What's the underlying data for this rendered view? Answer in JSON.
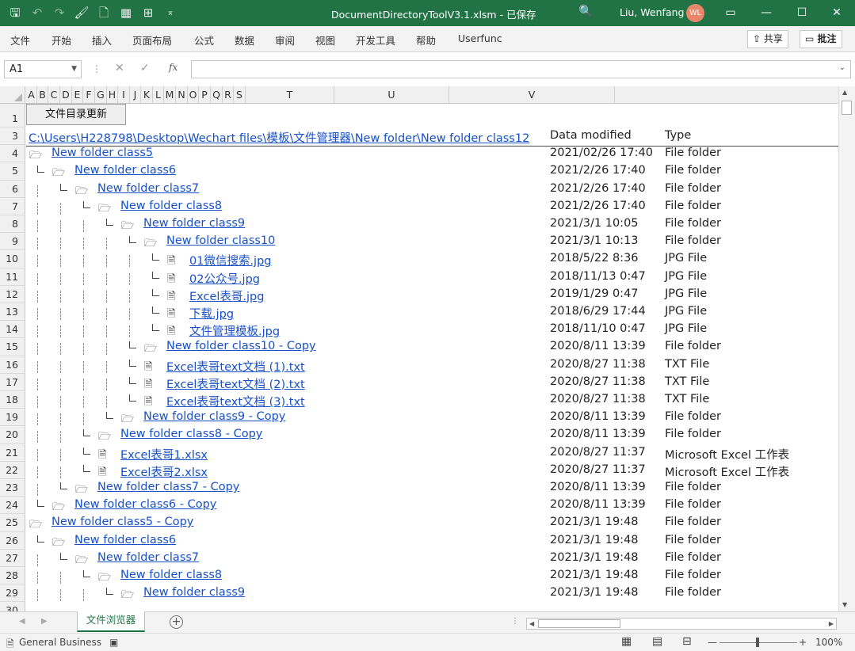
{
  "title": {
    "text": "DocumentDirectoryToolV3.1.xlsm  -  已保存",
    "user": "Liu, Wenfang",
    "avatar": "WL",
    "search_icon": "🔍",
    "qat_icons": [
      "save-icon",
      "undo-icon",
      "redo-icon",
      "format-painter-icon",
      "print-preview-icon",
      "table-icon",
      "borders-icon",
      "customize-qat-icon"
    ],
    "window_buttons": {
      "ribbon_display": "▭",
      "minimize": "—",
      "maximize": "☐",
      "close": "✕"
    },
    "accent": "#217346"
  },
  "ribbon": {
    "tabs": [
      "文件",
      "开始",
      "插入",
      "页面布局",
      "公式",
      "数据",
      "审阅",
      "视图",
      "开发工具",
      "帮助",
      "Userfunc"
    ],
    "share": "共享",
    "comments": "批注"
  },
  "formula_bar": {
    "name_box": "A1",
    "cancel": "✕",
    "enter": "✓",
    "fx": "fx",
    "value": ""
  },
  "columns": [
    "A",
    "B",
    "C",
    "D",
    "E",
    "F",
    "G",
    "H",
    "I",
    "J",
    "K",
    "L",
    "M",
    "N",
    "O",
    "P",
    "Q",
    "R",
    "S",
    "T",
    "U",
    "V"
  ],
  "row_numbers": [
    "1",
    "3",
    "4",
    "5",
    "6",
    "7",
    "8",
    "9",
    "10",
    "11",
    "12",
    "13",
    "14",
    "15",
    "16",
    "17",
    "18",
    "19",
    "20",
    "21",
    "22",
    "23",
    "24",
    "25",
    "26",
    "27",
    "28",
    "29",
    "30"
  ],
  "sheet": {
    "update_button": "文件目录更新",
    "path": "C:\\Users\\H228798\\Desktop\\Wechart files\\模板\\文件管理器\\New folder\\New folder class12",
    "header_date": "Data modified",
    "header_type": "Type",
    "rows": [
      {
        "depth": 0,
        "kind": "folder",
        "name": "New folder class5",
        "date": "2021/02/26 17:40",
        "type": "File folder"
      },
      {
        "depth": 1,
        "kind": "folder",
        "name": "New folder class6",
        "date": "2021/2/26 17:40",
        "type": "File folder"
      },
      {
        "depth": 2,
        "kind": "folder",
        "name": "New folder class7",
        "date": "2021/2/26 17:40",
        "type": "File folder"
      },
      {
        "depth": 3,
        "kind": "folder",
        "name": "New folder class8",
        "date": "2021/2/26 17:40",
        "type": "File folder"
      },
      {
        "depth": 4,
        "kind": "folder",
        "name": "New folder class9",
        "date": "2021/3/1 10:05",
        "type": "File folder"
      },
      {
        "depth": 5,
        "kind": "folder",
        "name": "New folder class10",
        "date": "2021/3/1 10:13",
        "type": "File folder"
      },
      {
        "depth": 6,
        "kind": "file",
        "name": "01微信搜索.jpg",
        "date": "2018/5/22 8:36",
        "type": "JPG File"
      },
      {
        "depth": 6,
        "kind": "file",
        "name": "02公众号.jpg",
        "date": "2018/11/13 0:47",
        "type": "JPG File"
      },
      {
        "depth": 6,
        "kind": "file",
        "name": "Excel表哥.jpg",
        "date": "2019/1/29 0:47",
        "type": "JPG File"
      },
      {
        "depth": 6,
        "kind": "file",
        "name": "下载.jpg",
        "date": "2018/6/29 17:44",
        "type": "JPG File"
      },
      {
        "depth": 6,
        "kind": "file",
        "name": "文件管理模板.jpg",
        "date": "2018/11/10 0:47",
        "type": "JPG File"
      },
      {
        "depth": 5,
        "kind": "folder",
        "name": "New folder class10 - Copy",
        "date": "2020/8/11 13:39",
        "type": "File folder"
      },
      {
        "depth": 5,
        "kind": "file",
        "name": "Excel表哥text文档 (1).txt",
        "date": "2020/8/27 11:38",
        "type": "TXT File"
      },
      {
        "depth": 5,
        "kind": "file",
        "name": "Excel表哥text文档 (2).txt",
        "date": "2020/8/27 11:38",
        "type": "TXT File"
      },
      {
        "depth": 5,
        "kind": "file",
        "name": "Excel表哥text文档 (3).txt",
        "date": "2020/8/27 11:38",
        "type": "TXT File"
      },
      {
        "depth": 4,
        "kind": "folder",
        "name": "New folder class9 - Copy",
        "date": "2020/8/11 13:39",
        "type": "File folder"
      },
      {
        "depth": 3,
        "kind": "folder",
        "name": "New folder class8 - Copy",
        "date": "2020/8/11 13:39",
        "type": "File folder"
      },
      {
        "depth": 3,
        "kind": "file",
        "name": "Excel表哥1.xlsx",
        "date": "2020/8/27 11:37",
        "type": "Microsoft Excel 工作表"
      },
      {
        "depth": 3,
        "kind": "file",
        "name": "Excel表哥2.xlsx",
        "date": "2020/8/27 11:37",
        "type": "Microsoft Excel 工作表"
      },
      {
        "depth": 2,
        "kind": "folder",
        "name": "New folder class7 - Copy",
        "date": "2020/8/11 13:39",
        "type": "File folder"
      },
      {
        "depth": 1,
        "kind": "folder",
        "name": "New folder class6 - Copy",
        "date": "2020/8/11 13:39",
        "type": "File folder"
      },
      {
        "depth": 0,
        "kind": "folder",
        "name": "New folder class5 - Copy",
        "date": "2021/3/1 19:48",
        "type": "File folder"
      },
      {
        "depth": 1,
        "kind": "folder",
        "name": "New folder class6",
        "date": "2021/3/1 19:48",
        "type": "File folder"
      },
      {
        "depth": 2,
        "kind": "folder",
        "name": "New folder class7",
        "date": "2021/3/1 19:48",
        "type": "File folder"
      },
      {
        "depth": 3,
        "kind": "folder",
        "name": "New folder class8",
        "date": "2021/3/1 19:48",
        "type": "File folder"
      },
      {
        "depth": 4,
        "kind": "folder",
        "name": "New folder class9",
        "date": "2021/3/1 19:48",
        "type": "File folder"
      }
    ]
  },
  "sheet_tabs": {
    "active": "文件浏览器",
    "add": "+"
  },
  "status": {
    "text": "General Business",
    "zoom": "100%",
    "zoom_minus": "—",
    "zoom_plus": "+",
    "zoom_level": 1.0
  }
}
